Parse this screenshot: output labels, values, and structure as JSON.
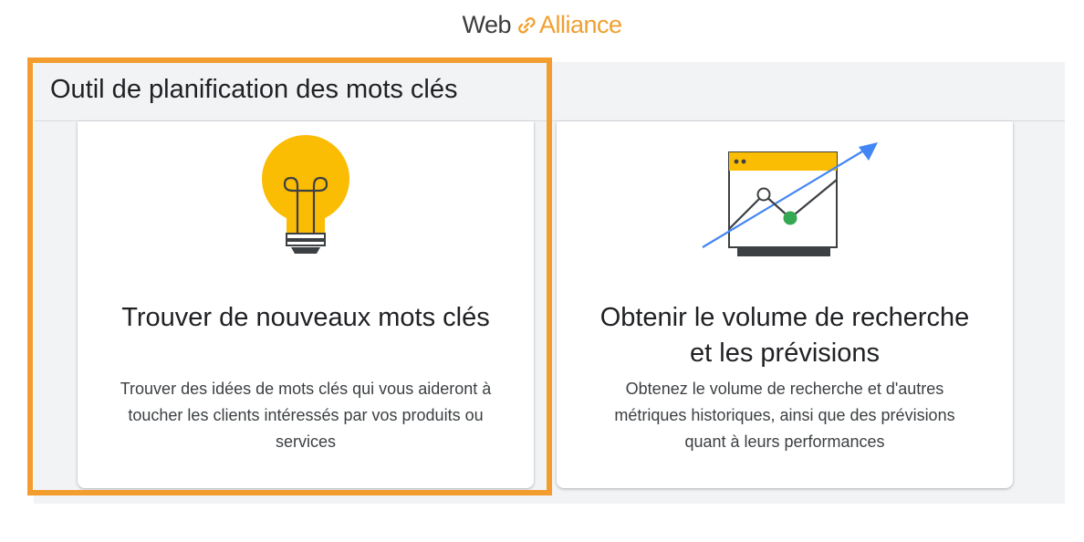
{
  "brand": {
    "web": "Web",
    "alliance": "Alliance"
  },
  "header": {
    "title": "Outil de planification des mots clés"
  },
  "cards": [
    {
      "title": "Trouver de nouveaux mots clés",
      "description": "Trouver des idées de mots clés qui vous aideront à toucher les clients intéressés par vos produits ou services",
      "icon": "lightbulb-icon"
    },
    {
      "title": "Obtenir le volume de recherche et les prévisions",
      "description": "Obtenez le volume de recherche et d'autres métriques historiques, ainsi que des prévisions quant à leurs performances",
      "icon": "forecast-chart-icon"
    }
  ],
  "colors": {
    "highlight": "#f29d2e",
    "brand_accent": "#f0a030",
    "bulb_yellow": "#fbbc04",
    "arrow_blue": "#4285f4",
    "point_green": "#34a853"
  }
}
